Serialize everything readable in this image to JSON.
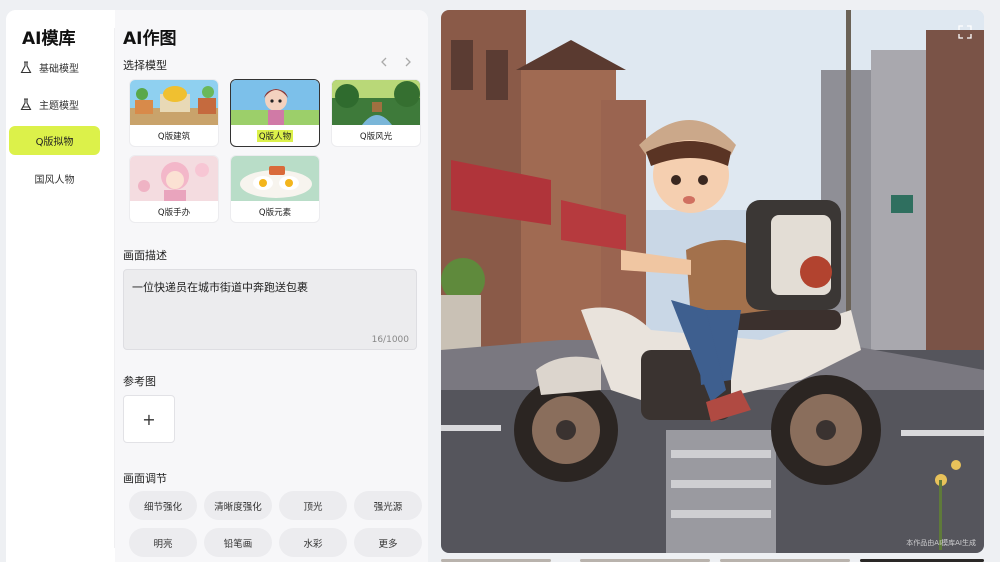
{
  "sidebar": {
    "brand": "AI模库",
    "items": [
      {
        "label": "基础模型",
        "icon": "flask-icon"
      },
      {
        "label": "主题模型",
        "icon": "flask-icon"
      },
      {
        "label": "Q版拟物",
        "active": true
      },
      {
        "label": "国风人物"
      }
    ]
  },
  "main": {
    "title": "AI作图",
    "model_section": "选择模型",
    "models": [
      {
        "label": "Q版建筑"
      },
      {
        "label": "Q版人物",
        "selected": true
      },
      {
        "label": "Q版风光"
      },
      {
        "label": "Q版手办"
      },
      {
        "label": "Q版元素"
      }
    ],
    "description_label": "画面描述",
    "description_value": "一位快递员在城市街道中奔跑送包裹",
    "description_counter": "16/1000",
    "reference_label": "参考图",
    "upload_symbol": "+",
    "adjust_label": "画面调节",
    "adjust_options": [
      "细节强化",
      "清晰度强化",
      "顶光",
      "强光源",
      "明亮",
      "铅笔画",
      "水彩",
      "更多"
    ]
  },
  "preview": {
    "watermark": "本作品由AI模库AI生成",
    "accent": "#dcf14a"
  }
}
